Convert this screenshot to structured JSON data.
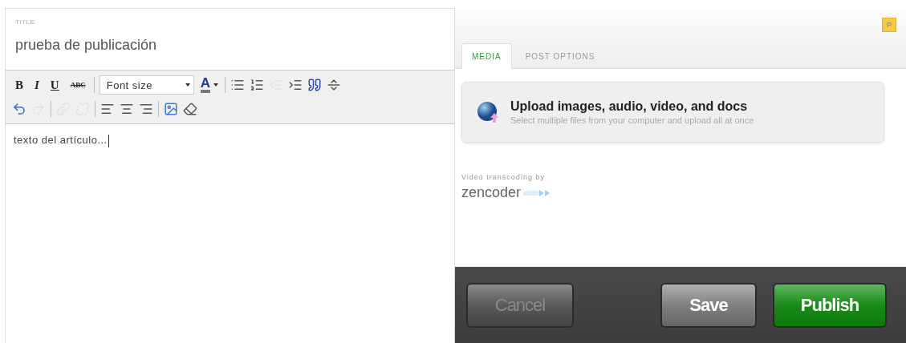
{
  "editor": {
    "title_label": "TITLE",
    "title_value": "prueba de publicación",
    "toolbar_rows": [
      [
        {
          "kind": "bold",
          "text": "B"
        },
        {
          "kind": "italic",
          "text": "I"
        },
        {
          "kind": "underline",
          "text": "U"
        },
        {
          "kind": "strike",
          "text": "ABC"
        },
        {
          "kind": "separator"
        },
        {
          "kind": "select",
          "text": "Font size"
        },
        {
          "kind": "color",
          "text": "A"
        },
        {
          "kind": "separator"
        },
        {
          "kind": "bullets",
          "disabled": false
        },
        {
          "kind": "numbers",
          "disabled": false
        },
        {
          "kind": "outdent",
          "disabled": true
        },
        {
          "kind": "indent",
          "disabled": false
        },
        {
          "kind": "quote",
          "disabled": false
        },
        {
          "kind": "rule",
          "disabled": false
        }
      ],
      [
        {
          "kind": "undo",
          "disabled": false
        },
        {
          "kind": "redo",
          "disabled": true
        },
        {
          "kind": "separator"
        },
        {
          "kind": "link",
          "disabled": true
        },
        {
          "kind": "unlink",
          "disabled": true
        },
        {
          "kind": "separator"
        },
        {
          "kind": "left",
          "disabled": false
        },
        {
          "kind": "center",
          "disabled": false
        },
        {
          "kind": "right",
          "disabled": false
        },
        {
          "kind": "separator"
        },
        {
          "kind": "image",
          "disabled": false
        },
        {
          "kind": "eraser",
          "disabled": false
        }
      ]
    ],
    "body": "texto del artículo..."
  },
  "side": {
    "badge": "P",
    "tabs": [
      {
        "label": "MEDIA",
        "selected": true
      },
      {
        "label": "POST OPTIONS",
        "selected": false
      }
    ],
    "upload": {
      "title": "Upload images, audio, video, and docs",
      "subtitle": "Select multiple files from your computer and upload all at once"
    },
    "transcoding_label": "Video transcoding by",
    "transcoding_brand": "zencoder"
  },
  "footer": {
    "buttons": [
      {
        "label": "Cancel",
        "kind": "cancel",
        "disabled": true
      },
      {
        "label": "Save",
        "kind": "save",
        "disabled": false
      },
      {
        "label": "Publish",
        "kind": "publish",
        "disabled": false
      }
    ]
  }
}
